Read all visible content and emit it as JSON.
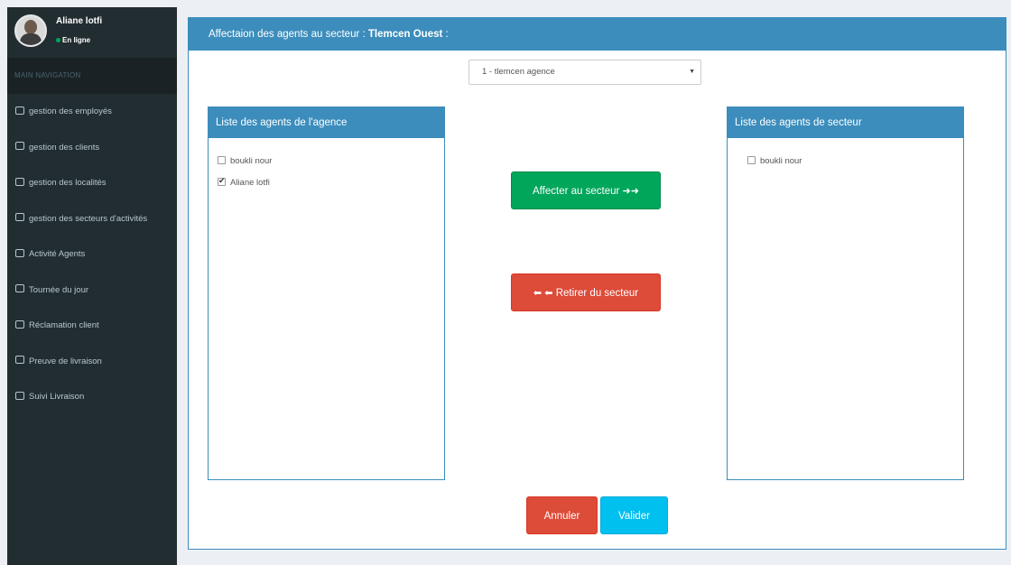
{
  "user": {
    "name": "Aliane lotfi",
    "status": "En ligne"
  },
  "nav": {
    "header": "MAIN NAVIGATION",
    "items": [
      {
        "label": "gestion des employés"
      },
      {
        "label": "gestion des clients"
      },
      {
        "label": "gestion des localités"
      },
      {
        "label": "gestion des secteurs d'activités"
      },
      {
        "label": "Activité Agents"
      },
      {
        "label": "Tournée du jour"
      },
      {
        "label": "Réclamation client"
      },
      {
        "label": "Preuve de livraison"
      },
      {
        "label": "Suivi Livraison"
      }
    ]
  },
  "main": {
    "title_prefix": "Affectaion des agents au secteur : ",
    "sector_name": "Tlemcen Ouest",
    "title_suffix": " :",
    "agency_select": {
      "value": "1 - tlemcen agence"
    },
    "left_panel": {
      "title": "Liste des agents de l'agence",
      "agents": [
        {
          "name": "boukli nour",
          "checked": false
        },
        {
          "name": "Aliane lotfi",
          "checked": true
        }
      ]
    },
    "right_panel": {
      "title": "Liste des agents de secteur",
      "agents": [
        {
          "name": "boukli nour",
          "checked": false
        }
      ]
    },
    "buttons": {
      "assign": "Affecter au secteur",
      "remove": "Retirer du secteur",
      "cancel": "Annuler",
      "validate": "Valider"
    }
  },
  "colors": {
    "sidebar": "#222d32",
    "primary": "#3c8dbc",
    "success": "#00a65a",
    "danger": "#dd4b39",
    "info": "#00c0ef"
  }
}
